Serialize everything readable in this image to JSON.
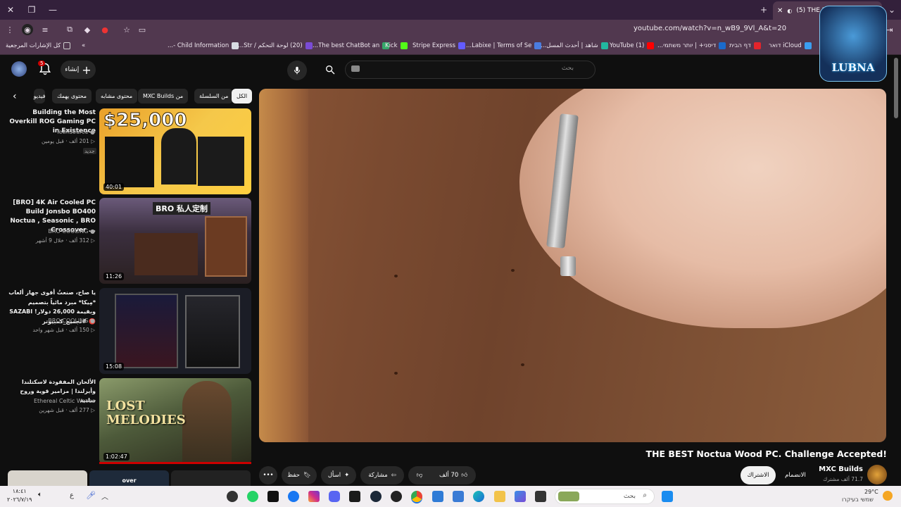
{
  "browser": {
    "tab_title": "(5) THE BEST Noctua Wo",
    "url": "youtube.com/watch?v=n_wB9_9Vl_A&t=20"
  },
  "bookmarks": [
    {
      "label": "كل الإشارات المرجعية",
      "color": "#9a86a8"
    },
    {
      "label": "Child Information -...",
      "color": "#d9dce4"
    },
    {
      "label": "(20) لوحة التحكم / Str...",
      "color": "#7a4bd6"
    },
    {
      "label": "The best ChatBot an...",
      "color": "#36a86a"
    },
    {
      "label": "Kick",
      "color": "#53fc18"
    },
    {
      "label": "Stripe Express",
      "color": "#635bff"
    },
    {
      "label": "Labixe | Terms of Se...",
      "color": "#4a7de0"
    },
    {
      "label": "شاهد | أحدث المسل...",
      "color": "#22b6a0"
    },
    {
      "label": "(1) YouTube",
      "color": "#ff0000"
    },
    {
      "label": "דיסני+ | יותר משתמי...",
      "color": "#1a6acc"
    },
    {
      "label": "דף הבית",
      "color": "#e3242b"
    },
    {
      "label": "iCloud דואר",
      "color": "#3a9ef0"
    }
  ],
  "yt": {
    "search_placeholder": "بحث",
    "create_label": "إنشاء",
    "notification_count": "5",
    "filter_chips": [
      "الكل",
      "من السلسلة",
      "من MXC Builds",
      "محتوى مشابه",
      "محتوى يهمك",
      "فيديو"
    ],
    "recommendations": [
      {
        "title": "Building the Most Overkill ROG Gaming PC in Existence",
        "channel": "TechSource",
        "views": "201 ألف",
        "age": "قبل يومين",
        "badge": "جديد",
        "duration": "40:01",
        "thumb_text": "$25,000"
      },
      {
        "title": "[BRO] 4K Air Cooled PC Build Jonsbo BO400 Noctua , Seasonic , BRO Crossover ...",
        "channel": "BRO COOLING",
        "views": "312 ألف",
        "age": "خلال 9 أشهر",
        "duration": "11:26",
        "thumb_text": "BRO 私人定制"
      },
      {
        "title": "يا صاح، صنعتُ أقوى جهاز ألعاب *مِيكا* مبرد مائياً بتصميم SAZABI وبقيمة 26,000 دولار! 🔴 #تجميع_كمبيوتر",
        "channel": "BRO COOLING",
        "views": "150 ألف",
        "age": "قبل شهر واحد",
        "duration": "15:08",
        "thumb_text": ""
      },
      {
        "title": "الألحان المفقودة لاسكتلندا وأيرلندا | مزامير قوية وروح سلتية",
        "channel": "Ethereal Celtic Waves",
        "views": "277 ألف",
        "age": "قبل شهرين",
        "duration": "1:02:47",
        "thumb_text": "LOST MELODIES"
      }
    ],
    "video_title": "THE BEST Noctua Wood PC. Challenge Accepted!",
    "channel_name": "MXC Builds",
    "subscribers": "71.7 ألف مشترك",
    "join_label": "الانضمام",
    "subscribed_label": "الاشتراك",
    "likes": "70 ألف",
    "share_label": "مشاركة",
    "ask_label": "اسأل",
    "save_label": "حفظ",
    "over_label": "over",
    "channel_watermark": "LUBNA"
  },
  "taskbar": {
    "search_placeholder": "بحث",
    "temp": "29°C",
    "weather": "שמשי בעיקרו",
    "time": "١٨:٤١",
    "date": "٢٠٢٦/٧/١٩",
    "lang": "ع"
  }
}
